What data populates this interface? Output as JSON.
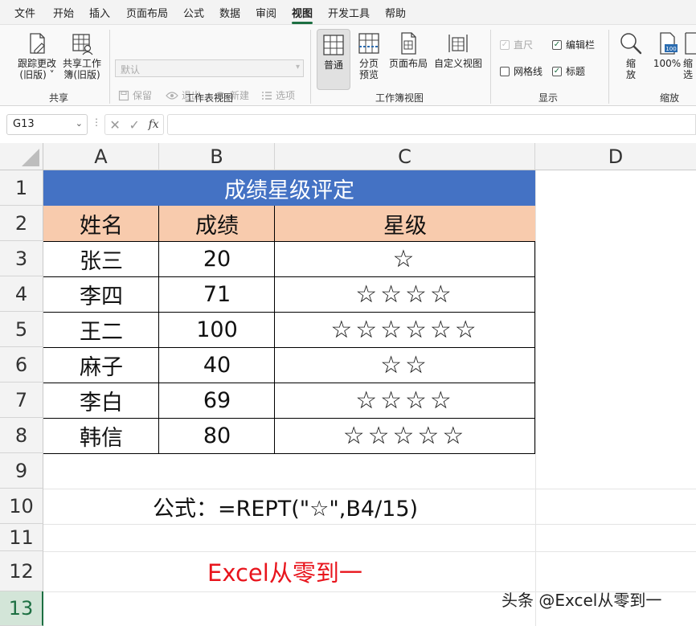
{
  "menu": {
    "items": [
      "文件",
      "开始",
      "插入",
      "页面布局",
      "公式",
      "数据",
      "审阅",
      "视图",
      "开发工具",
      "帮助"
    ],
    "active_index": 7
  },
  "ribbon": {
    "share_group": {
      "label": "共享",
      "track_changes": "跟踪更改\n(旧版) ˅",
      "share_workbook": "共享工作\n簿(旧版)"
    },
    "sheet_view_group": {
      "label": "工作表视图",
      "select_value": "默认",
      "keep": "保留",
      "exit": "退出",
      "new": "新建",
      "options": "选项"
    },
    "workbook_view_group": {
      "label": "工作簿视图",
      "normal": "普通",
      "page_break": "分页\n预览",
      "page_layout": "页面布局",
      "custom_view": "自定义视图"
    },
    "show_group": {
      "label": "显示",
      "ruler": "直尺",
      "formula_bar": "编辑栏",
      "gridlines": "网格线",
      "headings": "标题"
    },
    "zoom_group": {
      "label": "缩放",
      "zoom": "缩\n放",
      "zoom_100": "100%",
      "zoom_selection": "缩\n选",
      "icon_100": "100"
    }
  },
  "formula_bar": {
    "name_box": "G13",
    "dots": "⋮",
    "cancel": "✕",
    "confirm": "✓",
    "fx": "fx",
    "formula": ""
  },
  "sheet": {
    "columns": [
      "A",
      "B",
      "C",
      "D"
    ],
    "rows": [
      "1",
      "2",
      "3",
      "4",
      "5",
      "6",
      "7",
      "8",
      "9",
      "10",
      "11",
      "12",
      "13"
    ],
    "active_row_index": 12,
    "title": "成绩星级评定",
    "headers": [
      "姓名",
      "成绩",
      "星级"
    ],
    "records": [
      {
        "name": "张三",
        "score": "20",
        "stars": "☆"
      },
      {
        "name": "李四",
        "score": "71",
        "stars": "☆☆☆☆"
      },
      {
        "name": "王二",
        "score": "100",
        "stars": "☆☆☆☆☆☆"
      },
      {
        "name": "麻子",
        "score": "40",
        "stars": "☆☆"
      },
      {
        "name": "李白",
        "score": "69",
        "stars": "☆☆☆☆"
      },
      {
        "name": "韩信",
        "score": "80",
        "stars": "☆☆☆☆☆"
      }
    ],
    "formula_note": "公式：=REPT(\"☆\",B4/15)",
    "brand_text": "Excel从零到一"
  },
  "watermark": "头条 @Excel从零到一",
  "colors": {
    "title_fill": "#4472c4",
    "header_fill": "#f8cbad",
    "brand_red": "#e8141c",
    "accent_green": "#1d6f42"
  }
}
